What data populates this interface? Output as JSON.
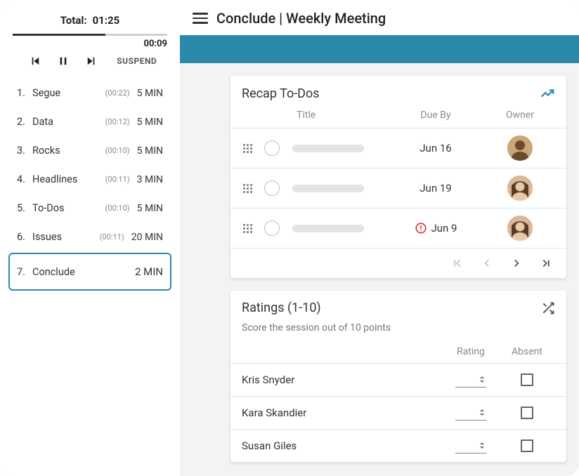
{
  "sidebar": {
    "total_label": "Total:",
    "total_value": "01:25",
    "elapsed": "00:09",
    "suspend_label": "SUSPEND",
    "items": [
      {
        "num": "1.",
        "label": "Segue",
        "time": "(00:22)",
        "dur": "5 MIN",
        "active": false
      },
      {
        "num": "2.",
        "label": "Data",
        "time": "(00:12)",
        "dur": "5 MIN",
        "active": false
      },
      {
        "num": "3.",
        "label": "Rocks",
        "time": "(00:10)",
        "dur": "5 MIN",
        "active": false
      },
      {
        "num": "4.",
        "label": "Headlines",
        "time": "(00:11)",
        "dur": "3 MIN",
        "active": false
      },
      {
        "num": "5.",
        "label": "To-Dos",
        "time": "(00:10)",
        "dur": "5 MIN",
        "active": false
      },
      {
        "num": "6.",
        "label": "Issues",
        "time": "(00:11)",
        "dur": "20 MIN",
        "active": false
      },
      {
        "num": "7.",
        "label": "Conclude",
        "time": "",
        "dur": "2 MIN",
        "active": true
      }
    ]
  },
  "header": {
    "title": "Conclude | Weekly Meeting"
  },
  "recap": {
    "title": "Recap To-Dos",
    "col_title": "Title",
    "col_due": "Due By",
    "col_owner": "Owner",
    "rows": [
      {
        "due": "Jun 16",
        "overdue": false,
        "avatar": 0
      },
      {
        "due": "Jun 19",
        "overdue": false,
        "avatar": 1
      },
      {
        "due": "Jun 9",
        "overdue": true,
        "avatar": 1
      }
    ]
  },
  "ratings": {
    "title": "Ratings (1-10)",
    "subtitle": "Score the session out of 10 points",
    "col_rating": "Rating",
    "col_absent": "Absent",
    "rows": [
      {
        "name": "Kris Snyder"
      },
      {
        "name": "Kara Skandier"
      },
      {
        "name": "Susan Giles"
      }
    ]
  }
}
